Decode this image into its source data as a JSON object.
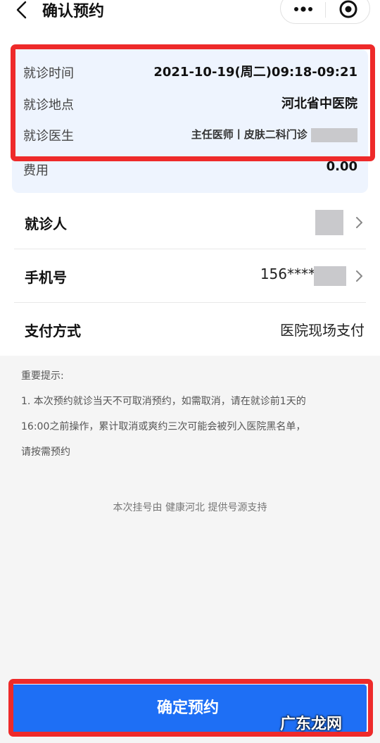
{
  "nav": {
    "title": "确认预约",
    "back_icon": "back-arrow-icon",
    "more_icon": "more-dots-icon",
    "close_icon": "target-close-icon"
  },
  "info": {
    "time_label": "就诊时间",
    "time_value": "2021-10-19(周二)09:18-09:21",
    "location_label": "就诊地点",
    "location_value": "河北省中医院",
    "doctor_label": "就诊医生",
    "doctor_value": "主任医师丨皮肤二科门诊",
    "fee_label": "费用",
    "fee_value": "0.00"
  },
  "rows": {
    "patient_label": "就诊人",
    "phone_label": "手机号",
    "phone_value": "156****",
    "payment_label": "支付方式",
    "payment_value": "医院现场支付"
  },
  "notice": {
    "title": "重要提示:",
    "line1": "1. 本次预约就诊当天不可取消预约，如需取消，请在就诊前1天的",
    "line2": "16:00之前操作，累计取消或爽约三次可能会被列入医院黑名单，",
    "line3": "请按需预约"
  },
  "support_text": "本次挂号由 健康河北 提供号源支持",
  "confirm_label": "确定预约",
  "watermark": "广东龙网",
  "colors": {
    "accent": "#1e6ff5",
    "highlight": "#ee2a2a",
    "card_bg": "#eef4fe"
  }
}
